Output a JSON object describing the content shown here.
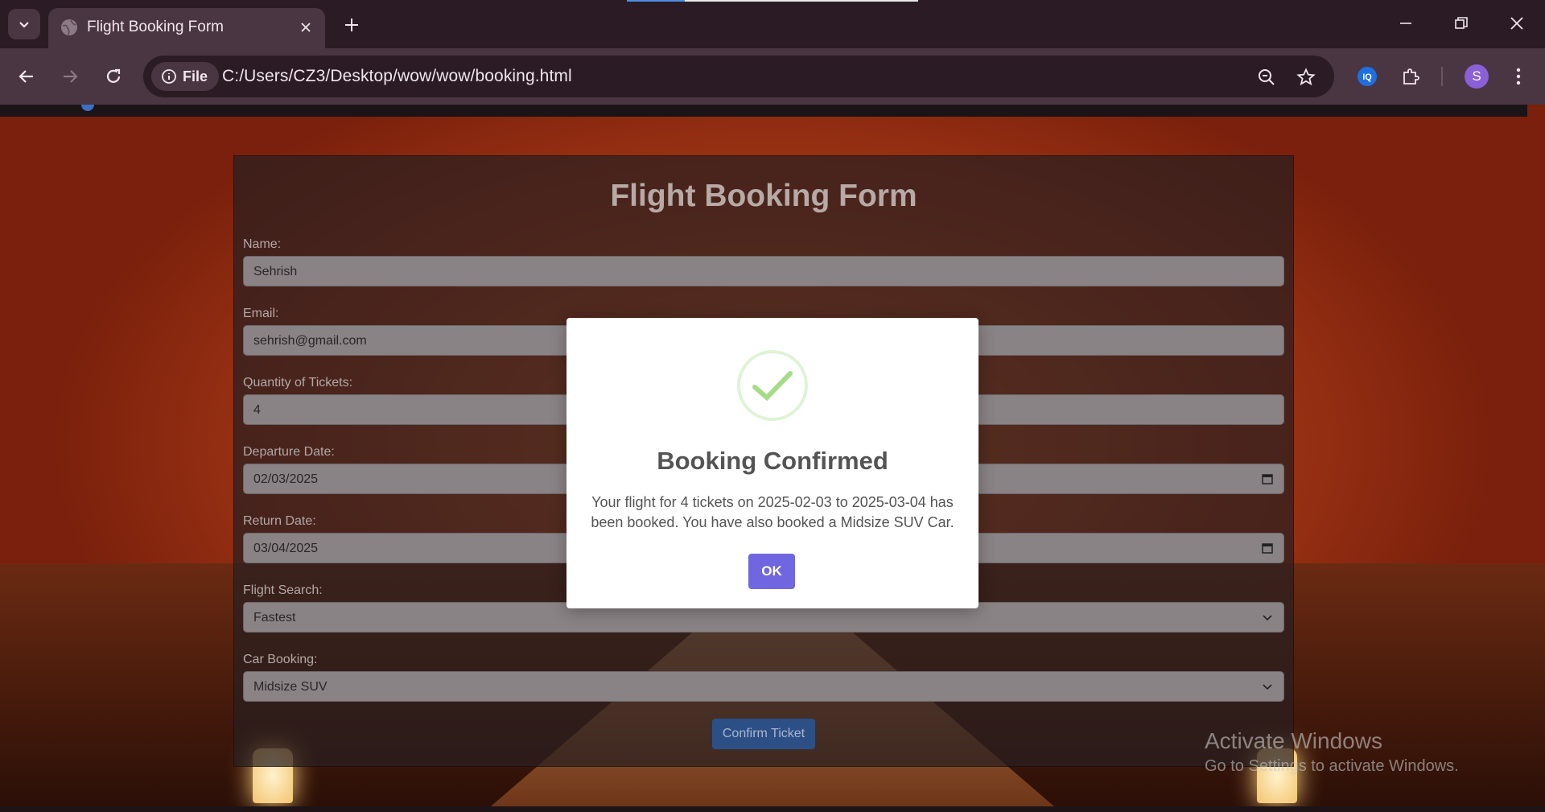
{
  "browser": {
    "tab_title": "Flight Booking Form",
    "tab_close_icon": "close-icon",
    "new_tab_icon": "plus-icon",
    "address_chip_label": "File",
    "url": "C:/Users/CZ3/Desktop/wow/wow/booking.html",
    "profile_initial": "S",
    "accent_color": "#8b5fd6"
  },
  "form": {
    "title": "Flight Booking Form",
    "fields": [
      {
        "label": "Name:",
        "value": "Sehrish"
      },
      {
        "label": "Email:",
        "value": "sehrish@gmail.com"
      },
      {
        "label": "Quantity of Tickets:",
        "value": "4"
      },
      {
        "label": "Departure Date:",
        "value": "02/03/2025",
        "icon": "calendar-icon"
      },
      {
        "label": "Return Date:",
        "value": "03/04/2025",
        "icon": "calendar-icon"
      },
      {
        "label": "Flight Search:",
        "value": "Fastest",
        "icon": "chevron-down-icon"
      },
      {
        "label": "Car Booking:",
        "value": "Midsize SUV",
        "icon": "chevron-down-icon"
      }
    ],
    "confirm_label": "Confirm Ticket",
    "confirm_color": "#2c4f86"
  },
  "modal": {
    "icon": "checkmark-icon",
    "title": "Booking Confirmed",
    "text": "Your flight for 4 tickets on 2025-02-03 to 2025-03-04 has been booked. You have also booked a Midsize SUV Car.",
    "ok_label": "OK",
    "ok_color": "#7066e0"
  },
  "watermark": {
    "line1": "Activate Windows",
    "line2": "Go to Settings to activate Windows."
  }
}
